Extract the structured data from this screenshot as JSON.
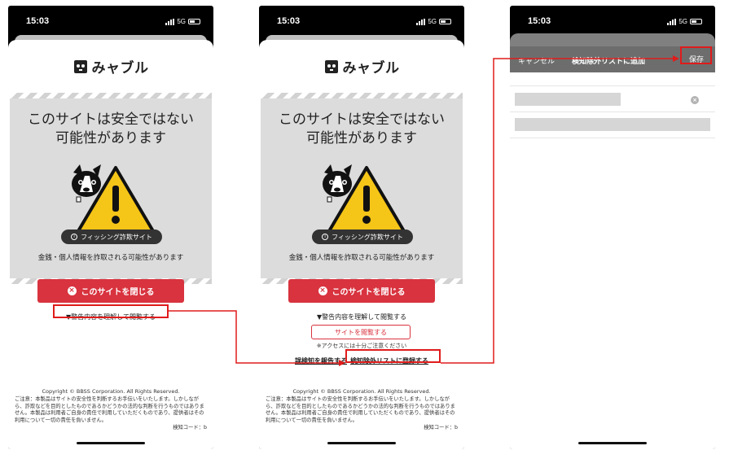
{
  "status": {
    "time": "15:03",
    "network": "5G"
  },
  "logo": {
    "text": "みャブル"
  },
  "warning": {
    "title_line1": "このサイトは安全ではない",
    "title_line2": "可能性があります",
    "badge": "フィッシング詐欺サイト",
    "description": "金銭・個人情報を詐取される可能性があります"
  },
  "actions": {
    "close_site": "このサイトを閉じる",
    "expand": "▼警告内容を理解して閲覧する",
    "view_site": "サイトを閲覧する",
    "caution": "※アクセスには十分ご注意ください",
    "report": "誤検知を報告する",
    "add_exclusion": "検知除外リストに登録する"
  },
  "footer": {
    "copyright": "Copyright © BBSS Corporation. All Rights Reserved.",
    "notice": "ご注意：本製品はサイトの安全性を判断するお手伝いをいたします。しかしながら、詐欺などを目的としたものであるかどうかの法的な判断を行うものではありません。本製品は利用者ご自身の責任で利用していただくものであり、提供者はその利用について一切の責任を負いません。",
    "detection_code": "検知コード：b"
  },
  "dialog": {
    "cancel": "キャンセル",
    "title": "検知除外リストに追加",
    "save": "保存"
  },
  "colors": {
    "accent_red": "#d8333f",
    "highlight": "#e01b1b"
  }
}
